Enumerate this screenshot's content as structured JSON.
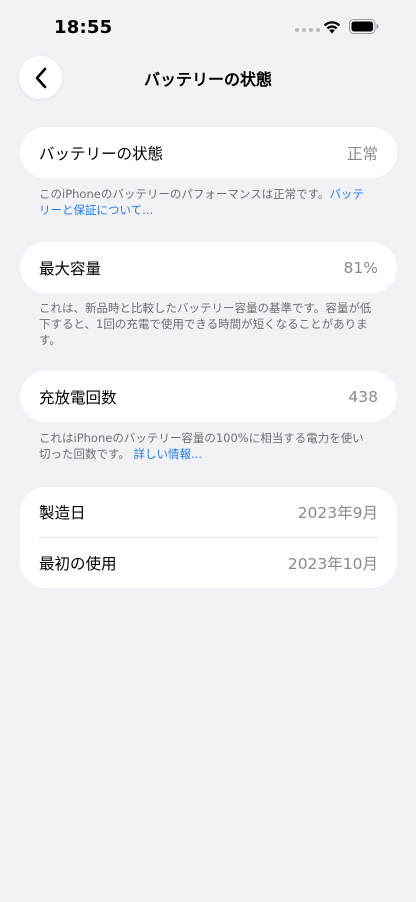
{
  "status_bar": {
    "time": "18:55"
  },
  "nav": {
    "title": "バッテリーの状態"
  },
  "battery_state": {
    "label": "バッテリーの状態",
    "value": "正常",
    "footnote_text": "このiPhoneのバッテリーのパフォーマンスは正常です。",
    "footnote_link": "バッテリーと保証について..."
  },
  "max_capacity": {
    "label": "最大容量",
    "value": "81%",
    "footnote_text": "これは、新品時と比較したバッテリー容量の基準です。容量が低下すると、1回の充電で使用できる時間が短くなることがあります。"
  },
  "cycle_count": {
    "label": "充放電回数",
    "value": "438",
    "footnote_text": "これはiPhoneのバッテリー容量の100%に相当する電力を使い切った回数です。",
    "footnote_link": "詳しい情報..."
  },
  "dates": {
    "manufacture_label": "製造日",
    "manufacture_value": "2023年9月",
    "first_use_label": "最初の使用",
    "first_use_value": "2023年10月"
  },
  "icons": {
    "back": "chevron-left-icon",
    "wifi": "wifi-icon",
    "battery": "battery-icon"
  },
  "colors": {
    "background": "#f2f1f6",
    "card": "#ffffff",
    "secondary_text": "#8a8a8e",
    "link": "#1a7bf2"
  }
}
